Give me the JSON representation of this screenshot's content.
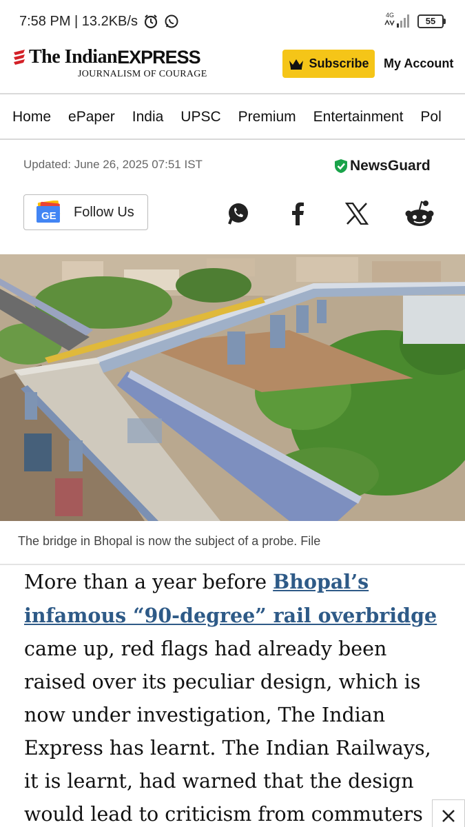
{
  "status_bar": {
    "time_speed": "7:58 PM | 13.2KB/s",
    "network": "4G",
    "battery": "55"
  },
  "header": {
    "logo_the": "The Indian",
    "logo_express": "EXPRESS",
    "tagline": "JOURNALISM OF COURAGE",
    "subscribe_label": "Subscribe",
    "account_label": "My Account",
    "accent_color": "#f5c518"
  },
  "nav": {
    "items": [
      "Home",
      "ePaper",
      "India",
      "UPSC",
      "Premium",
      "Entertainment",
      "Pol"
    ]
  },
  "meta": {
    "updated": "Updated: June 26, 2025 07:51 IST",
    "newsguard": "NewsGuard",
    "follow_label": "Follow Us"
  },
  "share_icons": [
    "whatsapp-icon",
    "facebook-icon",
    "x-icon",
    "reddit-icon"
  ],
  "image": {
    "caption": "The bridge in Bhopal is now the subject of a probe. File"
  },
  "article": {
    "text_before": "More than a year before ",
    "link_text": "Bhopal’s infamous “90-degree” rail overbridge",
    "text_after": " came up, red flags had already been raised over its peculiar design, which is now under investigation, The Indian Express has learnt. The Indian Railways, it is learnt, had warned that the design would lead to criticism from commuters and “give a bad"
  }
}
